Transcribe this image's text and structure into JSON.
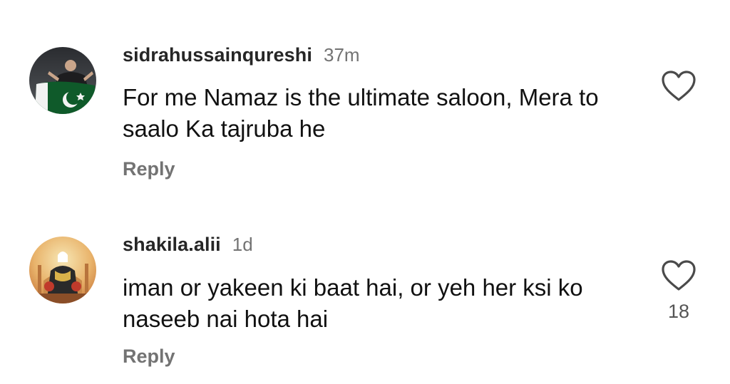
{
  "comments": [
    {
      "username": "sidrahussainqureshi",
      "time": "37m",
      "text": "For me Namaz is the ultimate saloon, Mera to saalo Ka tajruba he",
      "reply_label": "Reply",
      "avatar_icon": "flag-holder-avatar",
      "like_icon": "heart-icon"
    },
    {
      "username": "shakila.alii",
      "time": "1d",
      "text": "iman or yakeen ki baat hai, or yeh her ksi ko naseeb nai hota hai",
      "reply_label": "Reply",
      "like_count": "18",
      "avatar_icon": "illustrated-figure-avatar",
      "like_icon": "heart-icon"
    }
  ],
  "colors": {
    "text_primary": "#111111",
    "text_secondary": "#737373",
    "background": "#ffffff"
  }
}
